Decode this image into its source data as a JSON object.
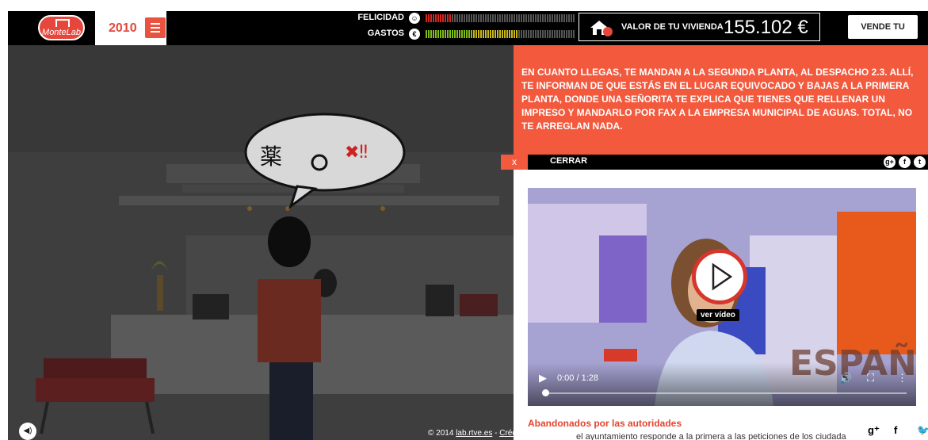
{
  "app": {
    "logo_text": "MonteLab",
    "year": "2010",
    "happiness_label": "FELICIDAD",
    "expenses_label": "GASTOS",
    "happiness_level": 0.17,
    "expenses_level": 0.62,
    "house_value_label": "VALOR DE TU VIVIENDA",
    "house_value": "155.102 €",
    "sell_button": "VENDE TU CASA"
  },
  "scene": {
    "footer_copyright": "© 2014",
    "footer_link": "lab.rtve.es",
    "footer_separator": " - ",
    "footer_credits": "Crédit"
  },
  "panel": {
    "story_text": "EN CUANTO LLEGAS, TE MANDAN A LA SEGUNDA PLANTA, AL DESPACHO 2.3. ALLÍ, TE INFORMAN DE QUE ESTÁS EN EL LUGAR EQUIVOCADO Y BAJAS A LA PRIMERA PLANTA, DONDE UNA SEÑORITA TE EXPLICA QUE TIENES QUE RELLENAR UN IMPRESO Y MANDARLO POR FAX A LA EMPRESA MUNICIPAL DE AGUAS. TOTAL, NO TE ARREGLAN NADA.",
    "close_x": "x",
    "close_label": "CERRAR",
    "video_time": "0:00 / 1:28",
    "video_progress": 0,
    "play_label": "ver vídeo",
    "video_banner_text": "ESPAÑA",
    "article_title": "Abandonados por las autoridades",
    "article_text": "el ayuntamiento responde a la primera a las peticiones de los ciudada"
  },
  "colors": {
    "accent": "#f2593d",
    "logo_red": "#e6463b",
    "topbar": "#000000",
    "scene_bg": "#3e3e3e"
  },
  "icons": [
    "menu-icon",
    "smiley-icon",
    "euro-icon",
    "house-icon",
    "google-plus-icon",
    "facebook-icon",
    "twitter-icon",
    "play-icon",
    "volume-icon",
    "fullscreen-icon",
    "more-options-icon",
    "sound-icon"
  ]
}
